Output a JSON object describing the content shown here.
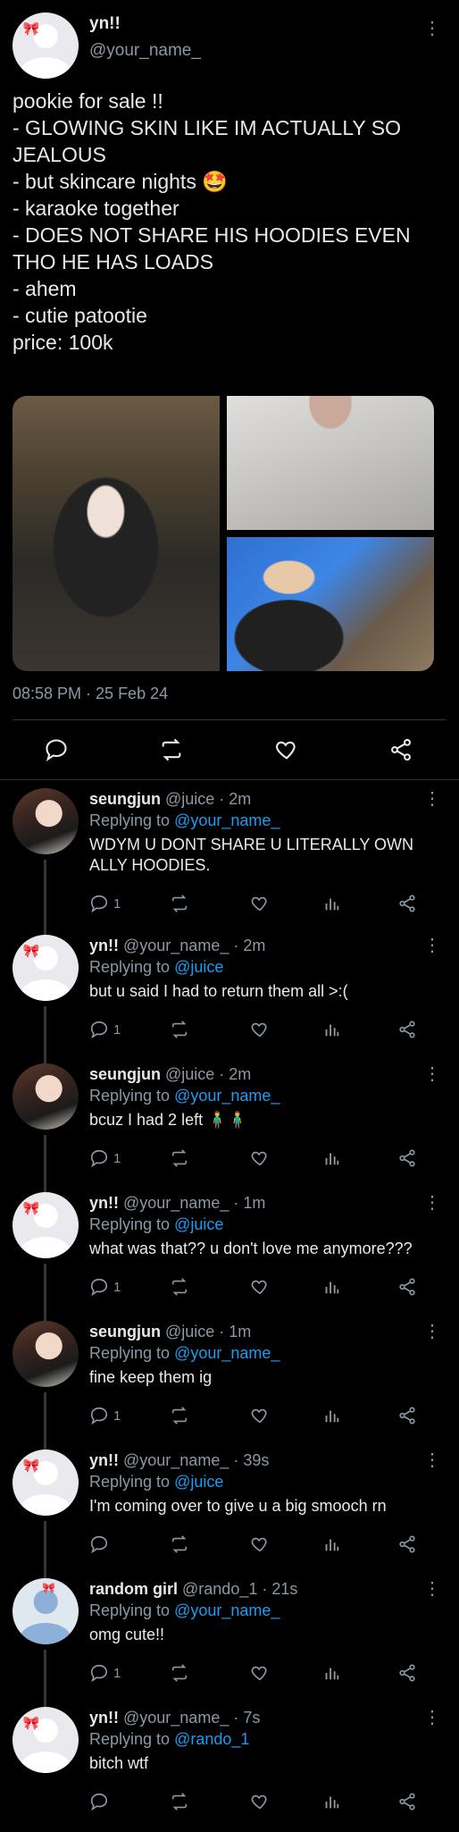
{
  "main_tweet": {
    "display_name": "yn!!",
    "handle": "@your_name_",
    "text": "pookie for sale !!\n- GLOWING SKIN LIKE IM ACTUALLY SO JEALOUS\n- but skincare nights 🤩\n- karaoke together\n- DOES NOT SHARE HIS HOODIES EVEN THO HE HAS LOADS\n- ahem\n- cutie patootie\nprice: 100k",
    "timestamp": "08:58 PM · 25 Feb 24"
  },
  "icons": {
    "reply": "reply-icon",
    "retweet": "retweet-icon",
    "like": "heart-icon",
    "share": "share-icon",
    "analytics": "analytics-icon",
    "more": "more-icon"
  },
  "replies": [
    {
      "name": "seungjun",
      "handle": "@juice",
      "time": "· 2m",
      "replying_prefix": "Replying to",
      "replying_to": "@your_name_",
      "text": "WDYM U DONT SHARE U LITERALLY OWN ALLY HOODIES.",
      "reply_count": "1"
    },
    {
      "name": "yn!!",
      "handle": "@your_name_",
      "time": "· 2m",
      "replying_prefix": "Replying to",
      "replying_to": "@juice",
      "text": "but u said I had to return them all >:(",
      "reply_count": "1"
    },
    {
      "name": "seungjun",
      "handle": "@juice",
      "time": "· 2m",
      "replying_prefix": "Replying to",
      "replying_to": "@your_name_",
      "text": "bcuz I had 2 left 🧍‍♂️🧍‍♂️",
      "reply_count": "1"
    },
    {
      "name": "yn!!",
      "handle": "@your_name_",
      "time": "· 1m",
      "replying_prefix": "Replying to",
      "replying_to": "@juice",
      "text": "what was that?? u don't love me anymore???",
      "reply_count": "1"
    },
    {
      "name": "seungjun",
      "handle": "@juice",
      "time": "· 1m",
      "replying_prefix": "Replying to",
      "replying_to": "@your_name_",
      "text": "fine keep them ig",
      "reply_count": "1"
    },
    {
      "name": "yn!!",
      "handle": "@your_name_",
      "time": "· 39s",
      "replying_prefix": "Replying to",
      "replying_to": "@juice",
      "text": "I'm coming over to give u a big smooch rn",
      "reply_count": ""
    },
    {
      "name": "random girl",
      "handle": "@rando_1",
      "time": "· 21s",
      "replying_prefix": "Replying to",
      "replying_to": "@your_name_",
      "text": "omg cute!!",
      "reply_count": "1"
    },
    {
      "name": "yn!!",
      "handle": "@your_name_",
      "time": "· 7s",
      "replying_prefix": "Replying to",
      "replying_to": "@rando_1",
      "text": "bitch wtf",
      "reply_count": ""
    }
  ]
}
